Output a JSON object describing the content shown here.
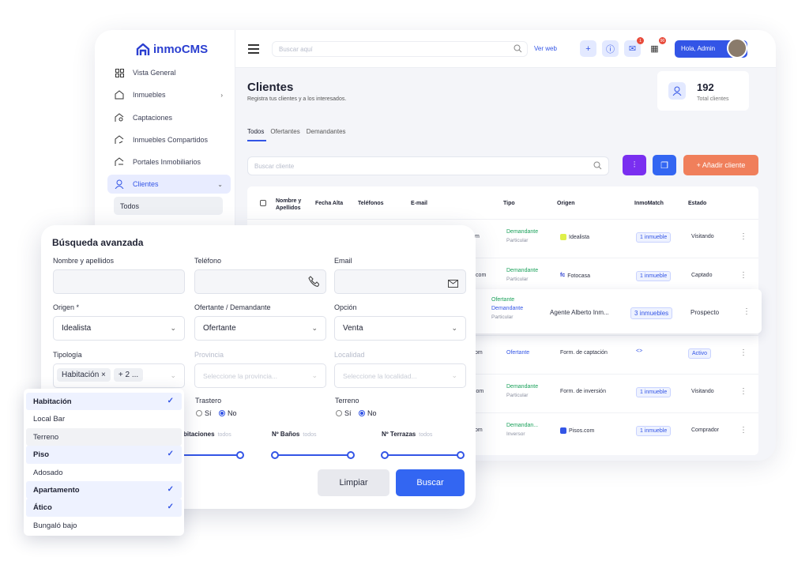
{
  "brand": {
    "name": "inmoCMS"
  },
  "sidebar": {
    "items": [
      {
        "label": "Vista General",
        "icon": "grid-icon"
      },
      {
        "label": "Inmuebles",
        "icon": "home-icon"
      },
      {
        "label": "Captaciones",
        "icon": "home-search-icon"
      },
      {
        "label": "Inmuebles Compartidos",
        "icon": "home-share-icon"
      },
      {
        "label": "Portales Inmobiliarios",
        "icon": "home-portal-icon"
      },
      {
        "label": "Clientes",
        "icon": "user-icon"
      }
    ],
    "sub_active": "Todos"
  },
  "topbar": {
    "search_placeholder": "Buscar aquí",
    "ver_web": "Ver web",
    "messages_badge": "1",
    "calendar_badge": "90",
    "greeting": "Hola, Admin"
  },
  "page": {
    "title": "Clientes",
    "subtitle": "Registra tus clientes y a los interesados.",
    "total": "192",
    "total_label": "Total clientes",
    "tabs": [
      "Todos",
      "Ofertantes",
      "Demandantes"
    ],
    "search_placeholder": "Buscar cliente",
    "add_label": "+ Añadir cliente"
  },
  "table": {
    "headers": [
      "Nombre y Apellidos",
      "Fecha Alta",
      "Teléfonos",
      "E-mail",
      "Tipo",
      "Origen",
      "InmoMatch",
      "Estado"
    ],
    "rows": [
      {
        "email_tail": "m",
        "tipo": "Demandante",
        "tipo_sub": "Particular",
        "origen": "Idealista",
        "match": "1 inmueble",
        "estado": "Visitando"
      },
      {
        "email_tail": "il.com",
        "tipo": "Demandante",
        "tipo_sub": "Particular",
        "origen": "Fotocasa",
        "match": "1 inmueble",
        "estado": "Captado"
      },
      {
        "email_tail": "",
        "tipo": "Ofertante",
        "tipo2": "Demandante",
        "tipo_sub": "Particular",
        "origen": "Agente Alberto Inm...",
        "match": "3 inmuebles",
        "estado": "Prospecto"
      },
      {
        "email_tail": "om",
        "tipo": "Ofertante",
        "tipo_sub": "",
        "origen": "Form. de captación",
        "match": "<>",
        "estado": "Activo"
      },
      {
        "email_tail": ".com",
        "tipo": "Demandante",
        "tipo_sub": "Particular",
        "origen": "Form. de inversión",
        "match": "1 inmueble",
        "estado": "Visitando"
      },
      {
        "email_tail": "om",
        "tipo": "Demandan...",
        "tipo_sub": "Inversor",
        "origen": "Pisos.com",
        "match": "1 inmueble",
        "estado": "Comprador"
      }
    ]
  },
  "modal": {
    "title": "Búsqueda avanzada",
    "labels": {
      "nombre": "Nombre y apellidos",
      "telefono": "Teléfono",
      "email": "Email",
      "origen": "Origen *",
      "ofdem": "Ofertante / Demandante",
      "opcion": "Opción",
      "tipologia": "Tipología",
      "provincia": "Provincia",
      "localidad": "Localidad",
      "trastero": "Trastero",
      "terreno": "Terreno"
    },
    "values": {
      "origen": "Idealista",
      "ofdem": "Ofertante",
      "opcion": "Venta",
      "chip1": "Habitación ×",
      "chip2": "+ 2 ...",
      "provincia_ph": "Seleccione la provincia...",
      "localidad_ph": "Seleccione la localidad..."
    },
    "radios": {
      "si": "Sí",
      "no": "No"
    },
    "sliders": {
      "habitaciones": "bitaciones",
      "banos": "Nº Baños",
      "terrazas": "Nº Terrazas",
      "todos": "todos"
    },
    "limpiar": "Limpiar",
    "buscar": "Buscar"
  },
  "dropdown": {
    "items": [
      {
        "label": "Habitación",
        "selected": true
      },
      {
        "label": "Local Bar",
        "selected": false
      },
      {
        "label": "Terreno",
        "selected": false
      },
      {
        "label": "Piso",
        "selected": true
      },
      {
        "label": "Adosado",
        "selected": false
      },
      {
        "label": "Apartamento",
        "selected": true
      },
      {
        "label": "Ático",
        "selected": true
      },
      {
        "label": "Bungaló bajo",
        "selected": false
      }
    ]
  },
  "colors": {
    "accent": "#3355e6",
    "add": "#f07f5b",
    "filter": "#7a2ff0",
    "green": "#1aa15a"
  }
}
